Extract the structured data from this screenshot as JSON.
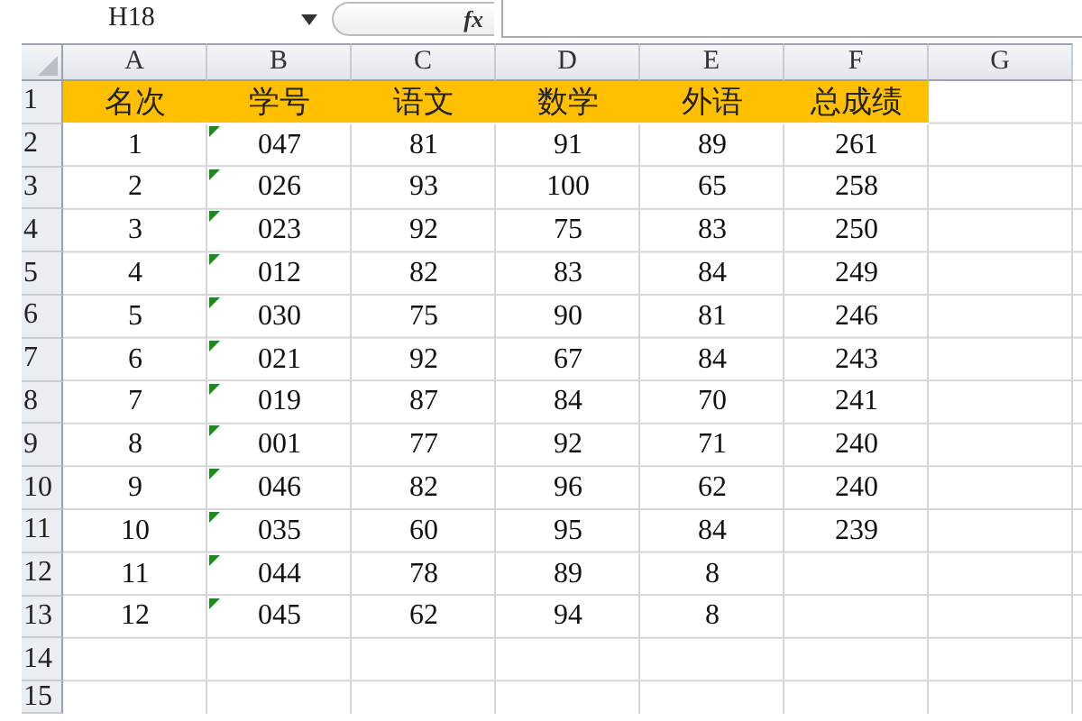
{
  "formula_bar": {
    "name_box": "H18",
    "fx": "fx"
  },
  "columns": [
    "A",
    "B",
    "C",
    "D",
    "E",
    "F",
    "G"
  ],
  "rows": [
    {
      "number": "1",
      "kind": "header",
      "cells": [
        "名次",
        "学号",
        "语文",
        "数学",
        "外语",
        "总成绩"
      ]
    },
    {
      "number": "2",
      "kind": "data",
      "flagged": true,
      "cells": [
        "1",
        "047",
        "81",
        "91",
        "89",
        "261"
      ]
    },
    {
      "number": "3",
      "kind": "data",
      "flagged": true,
      "cells": [
        "2",
        "026",
        "93",
        "100",
        "65",
        "258"
      ]
    },
    {
      "number": "4",
      "kind": "data",
      "flagged": true,
      "cells": [
        "3",
        "023",
        "92",
        "75",
        "83",
        "250"
      ]
    },
    {
      "number": "5",
      "kind": "data",
      "flagged": true,
      "cells": [
        "4",
        "012",
        "82",
        "83",
        "84",
        "249"
      ]
    },
    {
      "number": "6",
      "kind": "data",
      "flagged": true,
      "cells": [
        "5",
        "030",
        "75",
        "90",
        "81",
        "246"
      ]
    },
    {
      "number": "7",
      "kind": "data",
      "flagged": true,
      "cells": [
        "6",
        "021",
        "92",
        "67",
        "84",
        "243"
      ]
    },
    {
      "number": "8",
      "kind": "data",
      "flagged": true,
      "cells": [
        "7",
        "019",
        "87",
        "84",
        "70",
        "241"
      ]
    },
    {
      "number": "9",
      "kind": "data",
      "flagged": true,
      "cells": [
        "8",
        "001",
        "77",
        "92",
        "71",
        "240"
      ]
    },
    {
      "number": "10",
      "kind": "data",
      "flagged": true,
      "cells": [
        "9",
        "046",
        "82",
        "96",
        "62",
        "240"
      ]
    },
    {
      "number": "11",
      "kind": "data",
      "flagged": true,
      "cells": [
        "10",
        "035",
        "60",
        "95",
        "84",
        "239"
      ]
    },
    {
      "number": "12",
      "kind": "data",
      "flagged": true,
      "cells": [
        "11",
        "044",
        "78",
        "89",
        "8"
      ]
    },
    {
      "number": "13",
      "kind": "data",
      "flagged": true,
      "cells": [
        "12",
        "045",
        "62",
        "94",
        "8"
      ]
    },
    {
      "number": "14",
      "kind": "data",
      "cells": []
    },
    {
      "number": "15",
      "kind": "data",
      "cells": []
    }
  ]
}
